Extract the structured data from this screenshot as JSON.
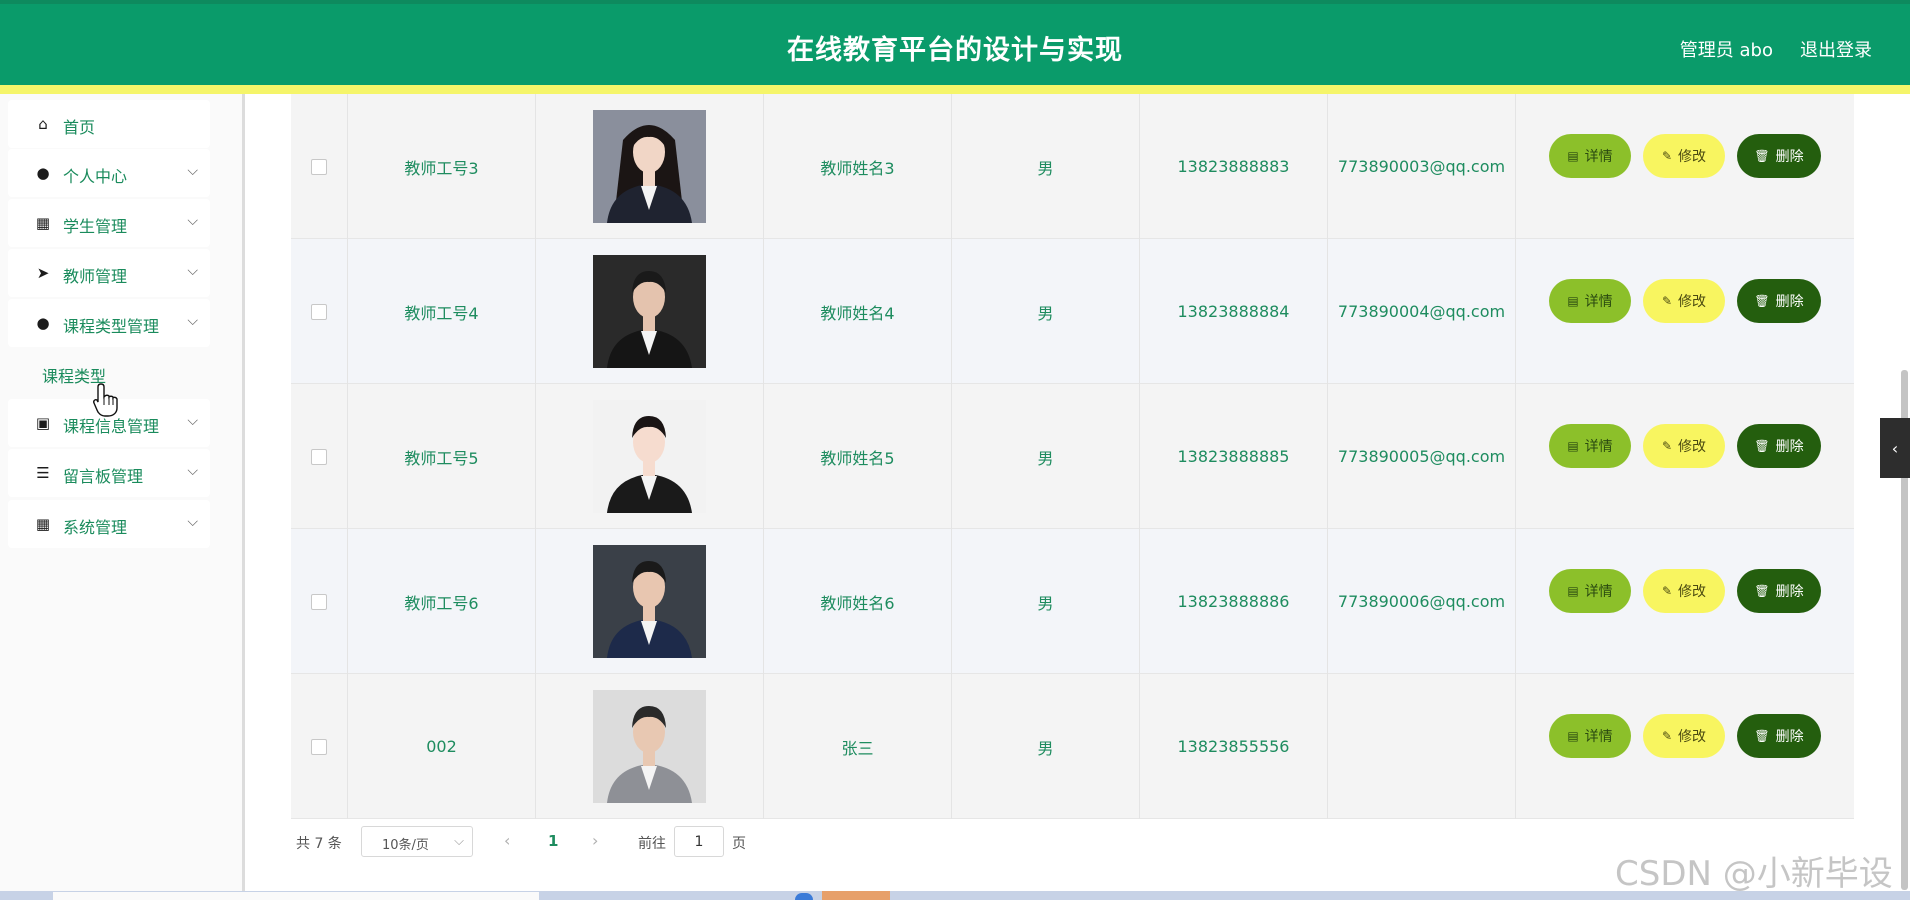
{
  "header": {
    "title": "在线教育平台的设计与实现",
    "user": "管理员 abo",
    "logout": "退出登录"
  },
  "sidebar": {
    "items": [
      {
        "label": "首页",
        "icon": "home-icon",
        "glyph": "⌂",
        "chevron": false
      },
      {
        "label": "个人中心",
        "icon": "user-icon",
        "glyph": "●",
        "chevron": true
      },
      {
        "label": "学生管理",
        "icon": "grid-icon",
        "glyph": "▦",
        "chevron": true
      },
      {
        "label": "教师管理",
        "icon": "paper-plane-icon",
        "glyph": "➤",
        "chevron": true
      },
      {
        "label": "课程类型管理",
        "icon": "user-icon",
        "glyph": "●",
        "chevron": true
      },
      {
        "label": "课程信息管理",
        "icon": "clipboard-icon",
        "glyph": "▣",
        "chevron": true
      },
      {
        "label": "留言板管理",
        "icon": "sliders-icon",
        "glyph": "☰",
        "chevron": true
      },
      {
        "label": "系统管理",
        "icon": "grid-icon",
        "glyph": "▦",
        "chevron": true
      }
    ],
    "sub_item": "课程类型"
  },
  "table": {
    "rows": [
      {
        "id": "教师工号3",
        "name": "教师姓名3",
        "gender": "男",
        "phone": "13823888883",
        "email": "773890003@qq.com"
      },
      {
        "id": "教师工号4",
        "name": "教师姓名4",
        "gender": "男",
        "phone": "13823888884",
        "email": "773890004@qq.com"
      },
      {
        "id": "教师工号5",
        "name": "教师姓名5",
        "gender": "男",
        "phone": "13823888885",
        "email": "773890005@qq.com"
      },
      {
        "id": "教师工号6",
        "name": "教师姓名6",
        "gender": "男",
        "phone": "13823888886",
        "email": "773890006@qq.com"
      },
      {
        "id": "002",
        "name": "张三",
        "gender": "男",
        "phone": "13823855556",
        "email": ""
      }
    ],
    "buttons": {
      "detail": "详情",
      "edit": "修改",
      "delete": "删除"
    }
  },
  "pagination": {
    "total": "共 7 条",
    "page_size": "10条/页",
    "current": "1",
    "goto_label": "前往",
    "goto_value": "1",
    "page_unit": "页"
  },
  "watermark": "CSDN @小新毕设",
  "colors": {
    "header": "#0a9b6a",
    "accent_line": "#f5f56a",
    "text_green": "#1e8c5f",
    "btn_detail": "#8cc02a",
    "btn_edit": "#f8f560",
    "btn_delete": "#245e0e"
  }
}
